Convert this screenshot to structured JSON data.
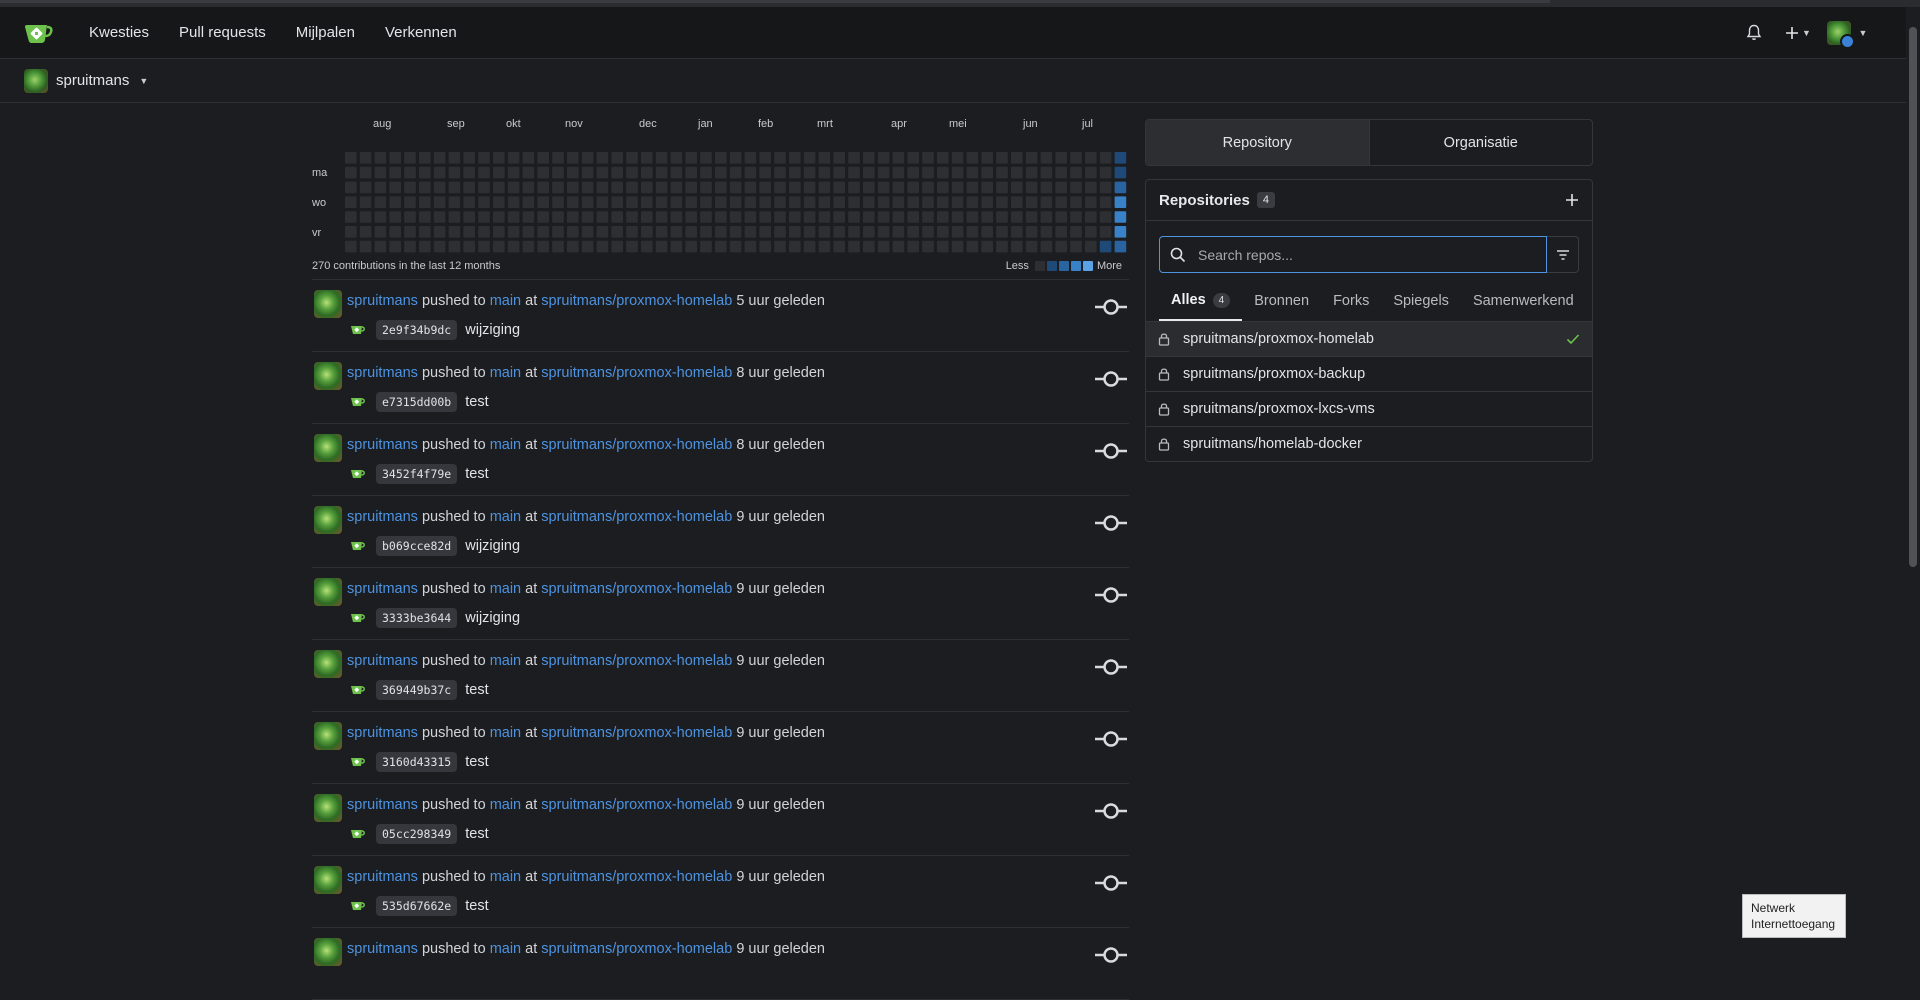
{
  "nav": {
    "links": [
      "Kwesties",
      "Pull requests",
      "Mijlpalen",
      "Verkennen"
    ]
  },
  "context": {
    "user": "spruitmans"
  },
  "heatmap": {
    "months": [
      "aug",
      "sep",
      "okt",
      "nov",
      "dec",
      "jan",
      "feb",
      "mrt",
      "apr",
      "mei",
      "jun",
      "jul"
    ],
    "days": [
      "ma",
      "wo",
      "vr"
    ],
    "summary": "270 contributions in the last 12 months",
    "legend_less": "Less",
    "legend_more": "More",
    "colors": [
      "#2d2f33",
      "#1f4a78",
      "#2a64a0",
      "#3a82c8",
      "#5aa2e6"
    ],
    "active_cells": [
      {
        "week": 52,
        "day": 2,
        "level": 2
      },
      {
        "week": 52,
        "day": 3,
        "level": 3
      },
      {
        "week": 52,
        "day": 4,
        "level": 3
      },
      {
        "week": 52,
        "day": 5,
        "level": 3
      },
      {
        "week": 52,
        "day": 6,
        "level": 2
      },
      {
        "week": 52,
        "day": 0,
        "level": 1
      },
      {
        "week": 52,
        "day": 1,
        "level": 1
      },
      {
        "week": 51,
        "day": 6,
        "level": 1
      }
    ]
  },
  "feed": {
    "pushed_to": "pushed to",
    "at": "at",
    "items": [
      {
        "user": "spruitmans",
        "branch": "main",
        "repo": "spruitmans/proxmox-homelab",
        "time": "5 uur geleden",
        "sha": "2e9f34b9dc",
        "message": "wijziging"
      },
      {
        "user": "spruitmans",
        "branch": "main",
        "repo": "spruitmans/proxmox-homelab",
        "time": "8 uur geleden",
        "sha": "e7315dd00b",
        "message": "test"
      },
      {
        "user": "spruitmans",
        "branch": "main",
        "repo": "spruitmans/proxmox-homelab",
        "time": "8 uur geleden",
        "sha": "3452f4f79e",
        "message": "test"
      },
      {
        "user": "spruitmans",
        "branch": "main",
        "repo": "spruitmans/proxmox-homelab",
        "time": "9 uur geleden",
        "sha": "b069cce82d",
        "message": "wijziging"
      },
      {
        "user": "spruitmans",
        "branch": "main",
        "repo": "spruitmans/proxmox-homelab",
        "time": "9 uur geleden",
        "sha": "3333be3644",
        "message": "wijziging"
      },
      {
        "user": "spruitmans",
        "branch": "main",
        "repo": "spruitmans/proxmox-homelab",
        "time": "9 uur geleden",
        "sha": "369449b37c",
        "message": "test"
      },
      {
        "user": "spruitmans",
        "branch": "main",
        "repo": "spruitmans/proxmox-homelab",
        "time": "9 uur geleden",
        "sha": "3160d43315",
        "message": "test"
      },
      {
        "user": "spruitmans",
        "branch": "main",
        "repo": "spruitmans/proxmox-homelab",
        "time": "9 uur geleden",
        "sha": "05cc298349",
        "message": "test"
      },
      {
        "user": "spruitmans",
        "branch": "main",
        "repo": "spruitmans/proxmox-homelab",
        "time": "9 uur geleden",
        "sha": "535d67662e",
        "message": "test"
      },
      {
        "user": "spruitmans",
        "branch": "main",
        "repo": "spruitmans/proxmox-homelab",
        "time": "9 uur geleden",
        "sha": "",
        "message": ""
      }
    ]
  },
  "panel": {
    "toggle": [
      "Repository",
      "Organisatie"
    ],
    "title": "Repositories",
    "count": "4",
    "search_placeholder": "Search repos...",
    "tabs": [
      {
        "label": "Alles",
        "count": "4"
      },
      {
        "label": "Bronnen"
      },
      {
        "label": "Forks"
      },
      {
        "label": "Spiegels"
      },
      {
        "label": "Samenwerkend"
      }
    ],
    "repos": [
      {
        "name": "spruitmans/proxmox-homelab",
        "selected": true
      },
      {
        "name": "spruitmans/proxmox-backup",
        "selected": false
      },
      {
        "name": "spruitmans/proxmox-lxcs-vms",
        "selected": false
      },
      {
        "name": "spruitmans/homelab-docker",
        "selected": false
      }
    ]
  },
  "tooltip": {
    "line1": "Netwerk",
    "line2": "Internettoegang"
  }
}
